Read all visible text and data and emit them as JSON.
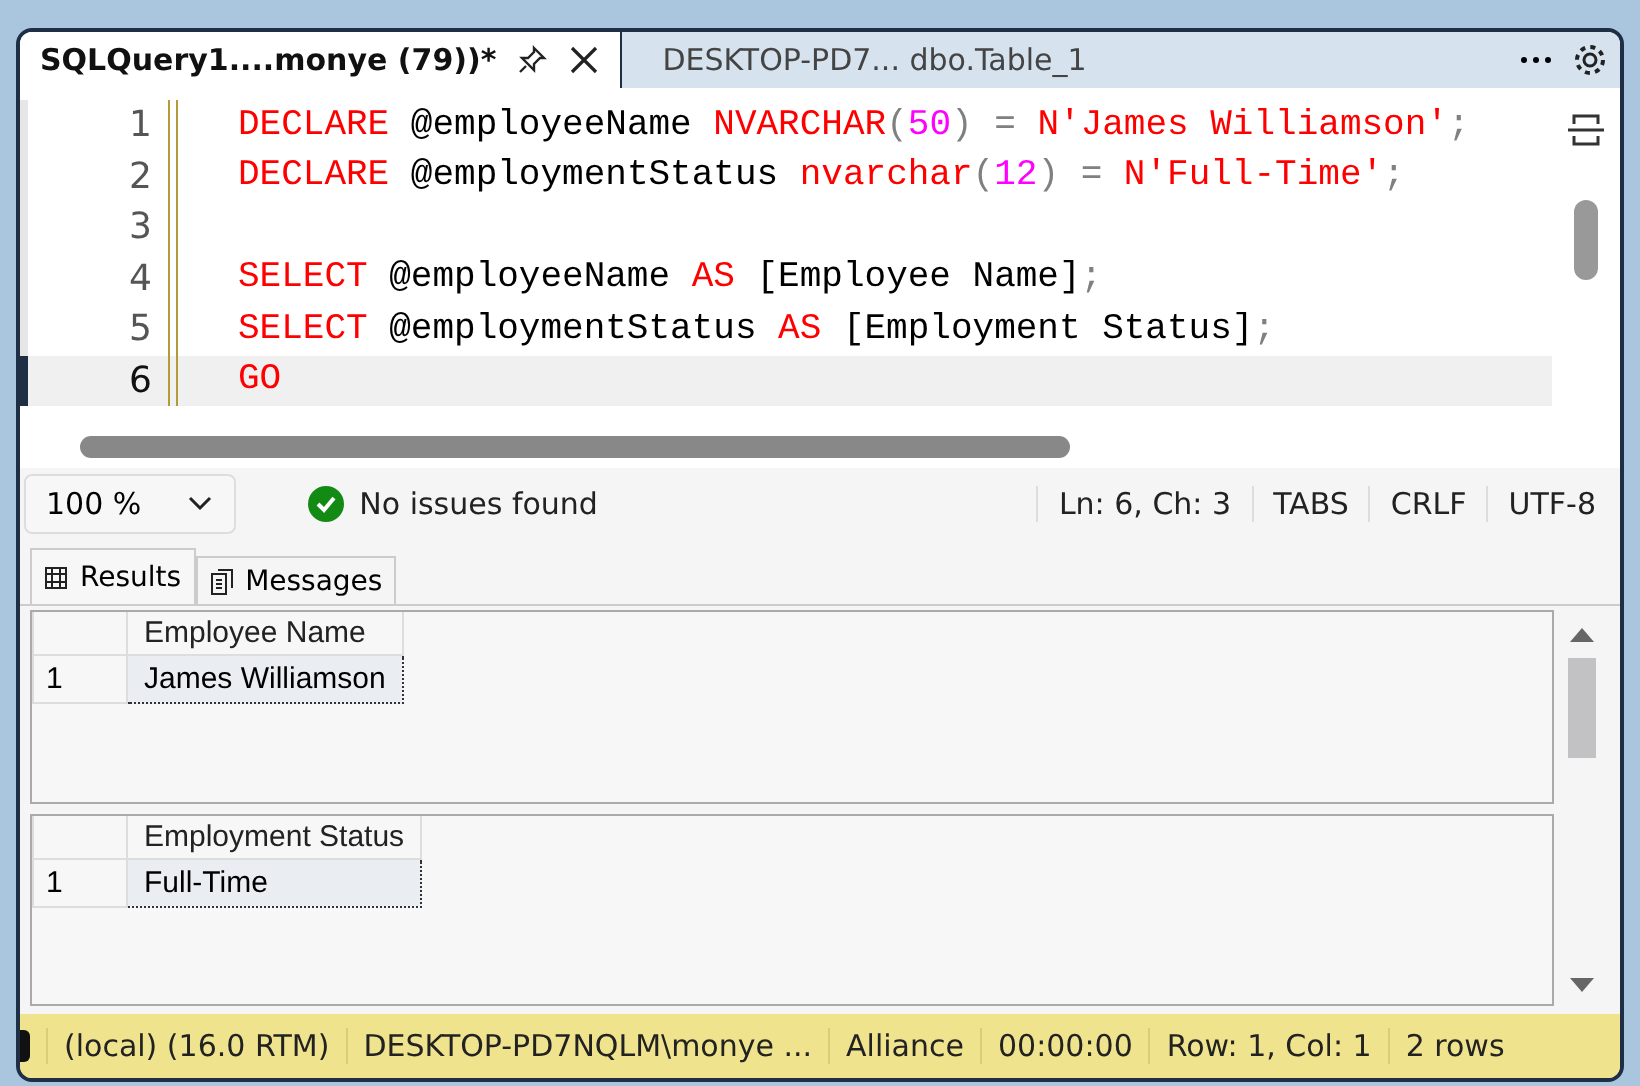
{
  "tabs": [
    {
      "label": "SQLQuery1....monye (79))*",
      "selected": true
    },
    {
      "label": "DESKTOP-PD7... dbo.Table_1",
      "selected": false
    }
  ],
  "editor": {
    "lines": [
      {
        "number": "1",
        "current": false,
        "tokens": [
          {
            "kind": "keyword",
            "text": "DECLARE"
          },
          {
            "kind": "plain",
            "text": " @employeeName "
          },
          {
            "kind": "keyword",
            "text": "NVARCHAR"
          },
          {
            "kind": "punct",
            "text": "("
          },
          {
            "kind": "number",
            "text": "50"
          },
          {
            "kind": "punct",
            "text": ")"
          },
          {
            "kind": "punct",
            "text": " = "
          },
          {
            "kind": "string",
            "text": "N'James Williamson'"
          },
          {
            "kind": "punct",
            "text": ";"
          }
        ]
      },
      {
        "number": "2",
        "current": false,
        "tokens": [
          {
            "kind": "keyword",
            "text": "DECLARE"
          },
          {
            "kind": "plain",
            "text": " @employmentStatus "
          },
          {
            "kind": "keyword",
            "text": "nvarchar"
          },
          {
            "kind": "punct",
            "text": "("
          },
          {
            "kind": "number",
            "text": "12"
          },
          {
            "kind": "punct",
            "text": ")"
          },
          {
            "kind": "punct",
            "text": " = "
          },
          {
            "kind": "string",
            "text": "N'Full-Time'"
          },
          {
            "kind": "punct",
            "text": ";"
          }
        ]
      },
      {
        "number": "3",
        "current": false
      },
      {
        "number": "4",
        "current": false,
        "tokens": [
          {
            "kind": "keyword",
            "text": "SELECT"
          },
          {
            "kind": "plain",
            "text": " @employeeName "
          },
          {
            "kind": "keyword",
            "text": "AS"
          },
          {
            "kind": "plain",
            "text": " [Employee Name]"
          },
          {
            "kind": "punct",
            "text": ";"
          }
        ]
      },
      {
        "number": "5",
        "current": false,
        "tokens": [
          {
            "kind": "keyword",
            "text": "SELECT"
          },
          {
            "kind": "plain",
            "text": " @employmentStatus "
          },
          {
            "kind": "keyword",
            "text": "AS"
          },
          {
            "kind": "plain",
            "text": " [Employment Status]"
          },
          {
            "kind": "punct",
            "text": ";"
          }
        ]
      },
      {
        "number": "6",
        "current": true,
        "tokens": [
          {
            "kind": "keyword",
            "text": "GO"
          }
        ]
      }
    ]
  },
  "editor_status": {
    "zoom": "100 %",
    "issues": "No issues found",
    "items": [
      "Ln: 6, Ch: 3",
      "TABS",
      "CRLF",
      "UTF-8"
    ]
  },
  "result_tabs": [
    {
      "label": "Results",
      "selected": true
    },
    {
      "label": "Messages",
      "selected": false
    }
  ],
  "grids": [
    {
      "columns": [
        "Employee Name"
      ],
      "rows": [
        {
          "number": "1",
          "cells": [
            "James Williamson"
          ]
        }
      ]
    },
    {
      "columns": [
        "Employment Status"
      ],
      "rows": [
        {
          "number": "1",
          "cells": [
            "Full-Time"
          ]
        }
      ]
    }
  ],
  "status_bar": [
    "(local) (16.0 RTM)",
    "DESKTOP-PD7NQLM\\monye ...",
    "Alliance",
    "00:00:00",
    "Row: 1, Col: 1",
    "2 rows"
  ]
}
